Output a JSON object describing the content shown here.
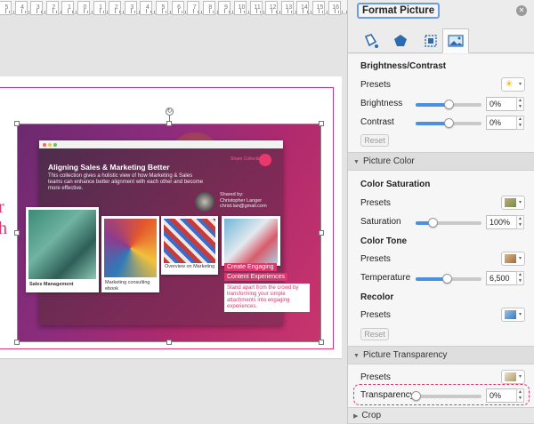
{
  "ruler": {
    "numbers": [
      "5",
      "4",
      "3",
      "2",
      "1",
      "0",
      "1",
      "2",
      "3",
      "4",
      "5",
      "6",
      "7",
      "8",
      "9",
      "10",
      "11",
      "12",
      "13",
      "14",
      "15",
      "16"
    ]
  },
  "slide": {
    "side_letters": [
      "r",
      "h"
    ],
    "picture": {
      "headline": "Aligning Sales & Marketing Better",
      "description": "This collection gives a holistic view of how Marketing & Sales teams can enhance better alignment with each other and become more effective.",
      "collection_label": "Share Collection",
      "shared_by": "Shared by:",
      "sharer_name": "Christopher Langer",
      "sharer_email": "christ.lan@gmail.com",
      "cards": [
        {
          "caption": "Sales Management"
        },
        {
          "caption": "Marketing consulting ebook"
        },
        {
          "caption": "Overview on Marketing"
        }
      ],
      "cta_label_1": "Create Engaging",
      "cta_label_2": "Content Experiences",
      "cta_text": "Stand apart from the crowd by transforming your simple attachments into engaging experiences."
    }
  },
  "pane": {
    "title": "Format Picture",
    "tabs": [
      "fill-and-line",
      "effects",
      "size-and-properties",
      "picture"
    ],
    "brightness_contrast": {
      "heading": "Brightness/Contrast",
      "presets_label": "Presets",
      "brightness_label": "Brightness",
      "brightness_value": "0%",
      "brightness_level": 0.5,
      "contrast_label": "Contrast",
      "contrast_value": "0%",
      "contrast_level": 0.5,
      "reset_label": "Reset"
    },
    "picture_color": {
      "heading": "Picture Color",
      "saturation_heading": "Color Saturation",
      "presets_label": "Presets",
      "saturation_label": "Saturation",
      "saturation_value": "100%",
      "saturation_level": 0.25,
      "tone_heading": "Color Tone",
      "tone_presets_label": "Presets",
      "temperature_label": "Temperature",
      "temperature_value": "6,500",
      "temperature_level": 0.47,
      "recolor_heading": "Recolor",
      "recolor_presets_label": "Presets",
      "reset_label": "Reset"
    },
    "picture_transparency": {
      "heading": "Picture Transparency",
      "presets_label": "Presets",
      "transparency_label": "Transparency",
      "transparency_value": "0%",
      "transparency_level": 0.0
    },
    "crop": {
      "heading": "Crop"
    },
    "colors": {
      "accent": "#4a90e2",
      "highlight": "#d8386c"
    }
  }
}
